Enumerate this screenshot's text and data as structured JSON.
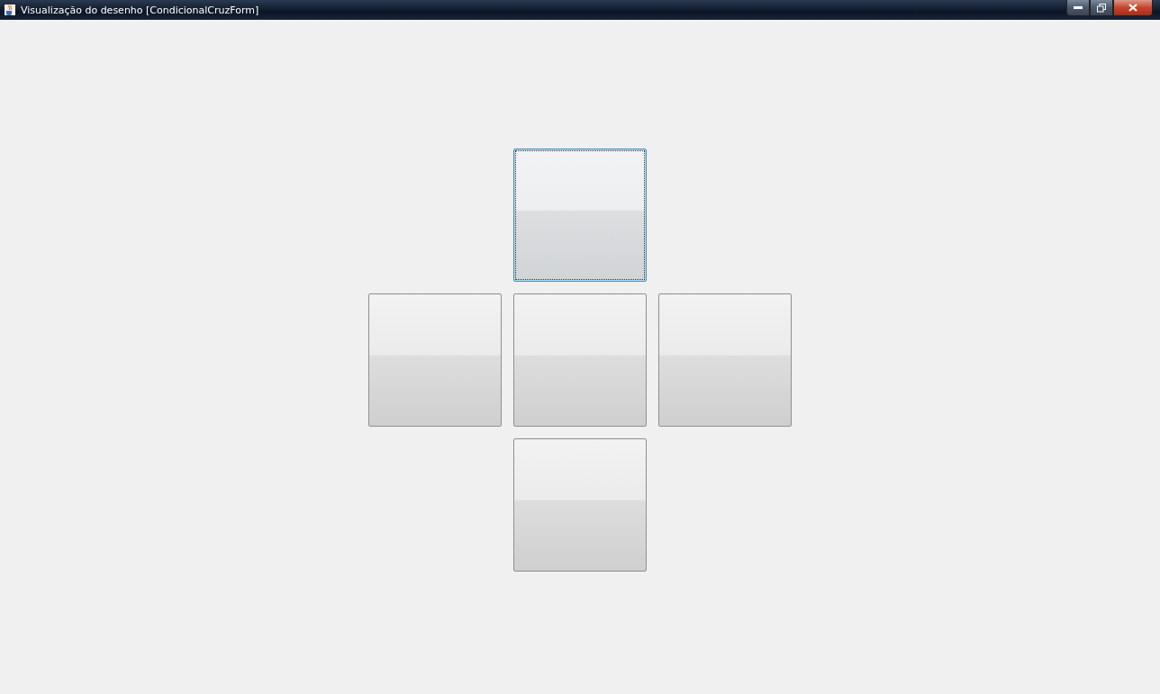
{
  "window": {
    "title": "Visualização do desenho [CondicionalCruzForm]"
  },
  "buttons": [
    {
      "kind": "top",
      "focused": true
    },
    {
      "kind": "left",
      "focused": false
    },
    {
      "kind": "center",
      "focused": false
    },
    {
      "kind": "right",
      "focused": false
    },
    {
      "kind": "bottom",
      "focused": false
    }
  ]
}
